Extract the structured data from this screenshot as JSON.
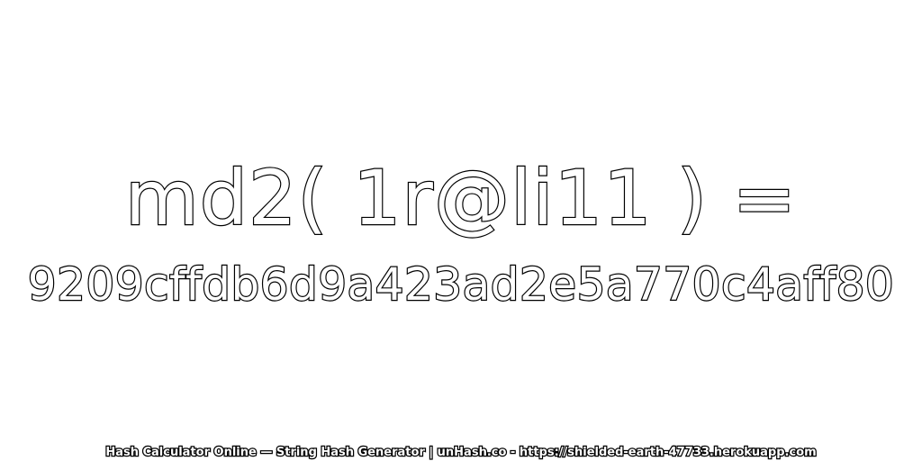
{
  "expression": "md2( 1r@li11 ) =",
  "hash_value": "9209cffdb6d9a423ad2e5a770c4aff80",
  "footer": "Hash Calculator Online — String Hash Generator | unHash.co - https://shielded-earth-47733.herokuapp.com",
  "colors": {
    "background": "#ffffff",
    "text_fill": "#ffffff",
    "text_outline": "#000000"
  }
}
